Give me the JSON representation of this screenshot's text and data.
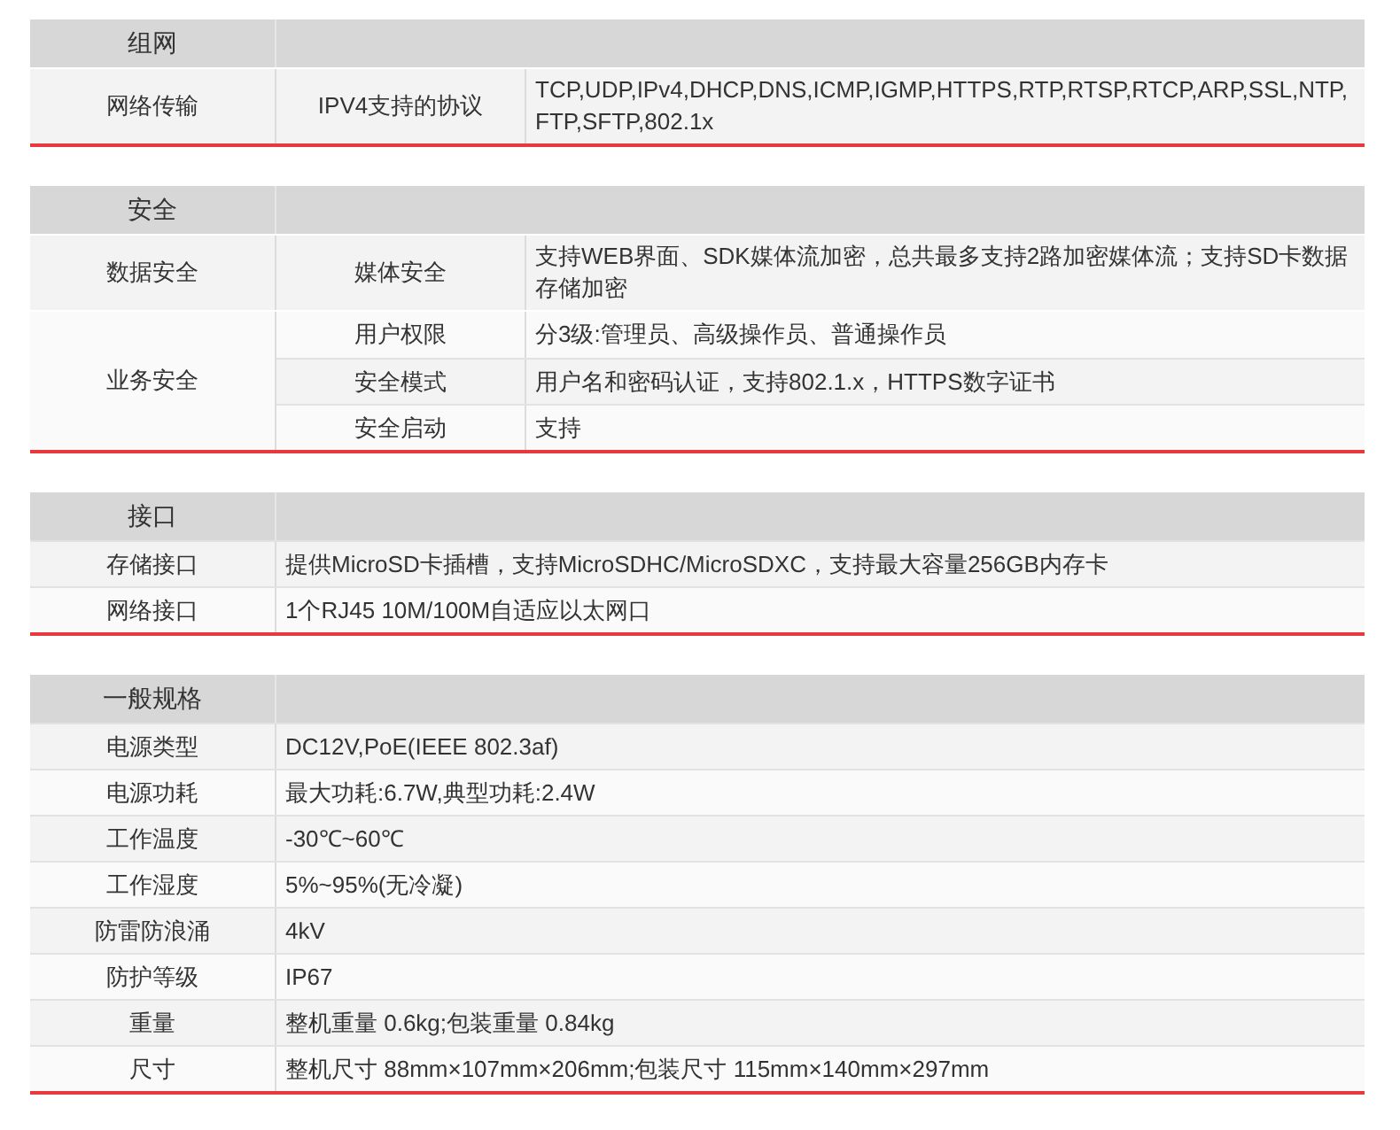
{
  "sections": [
    {
      "title": "组网",
      "groups": [
        {
          "label": "网络传输",
          "items": [
            {
              "label": "IPV4支持的协议",
              "value": "TCP,UDP,IPv4,DHCP,DNS,ICMP,IGMP,HTTPS,RTP,RTSP,RTCP,ARP,SSL,NTP,FTP,SFTP,802.1x"
            }
          ]
        }
      ]
    },
    {
      "title": "安全",
      "groups": [
        {
          "label": "数据安全",
          "items": [
            {
              "label": "媒体安全",
              "value": "支持WEB界面、SDK媒体流加密，总共最多支持2路加密媒体流；支持SD卡数据存储加密"
            }
          ]
        },
        {
          "label": "业务安全",
          "items": [
            {
              "label": "用户权限",
              "value": "分3级:管理员、高级操作员、普通操作员"
            },
            {
              "label": "安全模式",
              "value": "用户名和密码认证，支持802.1.x，HTTPS数字证书"
            },
            {
              "label": "安全启动",
              "value": "支持"
            }
          ]
        }
      ]
    },
    {
      "title": "接口",
      "rows": [
        {
          "label": "存储接口",
          "value": "提供MicroSD卡插槽，支持MicroSDHC/MicroSDXC，支持最大容量256GB内存卡"
        },
        {
          "label": "网络接口",
          "value": "1个RJ45 10M/100M自适应以太网口"
        }
      ]
    },
    {
      "title": "一般规格",
      "rows": [
        {
          "label": "电源类型",
          "value": "DC12V,PoE(IEEE 802.3af)"
        },
        {
          "label": "电源功耗",
          "value": "最大功耗:6.7W,典型功耗:2.4W"
        },
        {
          "label": "工作温度",
          "value": "-30℃~60℃"
        },
        {
          "label": "工作湿度",
          "value": "5%~95%(无冷凝)"
        },
        {
          "label": "防雷防浪涌",
          "value": "4kV"
        },
        {
          "label": "防护等级",
          "value": "IP67"
        },
        {
          "label": "重量",
          "value": "整机重量 0.6kg;包装重量 0.84kg"
        },
        {
          "label": "尺寸",
          "value": "整机尺寸 88mm×107mm×206mm;包装尺寸 115mm×140mm×297mm"
        }
      ]
    }
  ]
}
